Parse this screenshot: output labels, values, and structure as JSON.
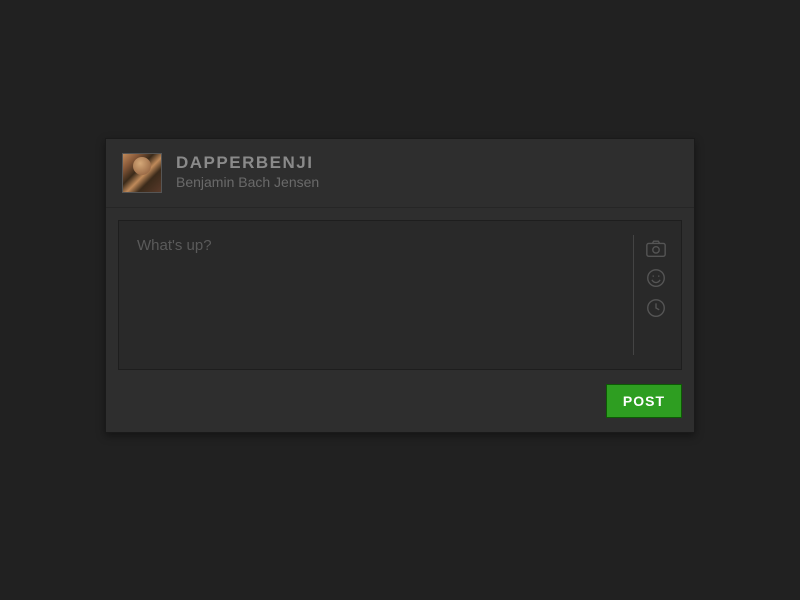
{
  "user": {
    "handle": "DAPPERBENJI",
    "full_name": "Benjamin Bach Jensen"
  },
  "compose": {
    "placeholder": "What's up?",
    "value": ""
  },
  "actions": {
    "camera": "camera-icon",
    "emoji": "emoji-icon",
    "schedule": "clock-icon"
  },
  "buttons": {
    "post": "POST"
  },
  "colors": {
    "accent": "#2e9e21",
    "background": "#212121",
    "panel": "#2e2e2e",
    "input": "#292929"
  }
}
